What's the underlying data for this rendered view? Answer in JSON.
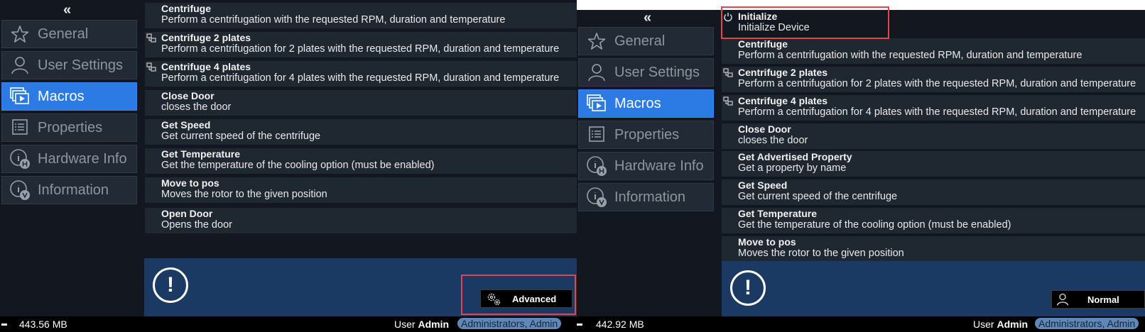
{
  "left": {
    "collapse_label": "«",
    "nav": [
      {
        "label": "General",
        "icon": "star-icon"
      },
      {
        "label": "User Settings",
        "icon": "user-icon"
      },
      {
        "label": "Macros",
        "icon": "macros-icon"
      },
      {
        "label": "Properties",
        "icon": "properties-icon"
      },
      {
        "label": "Hardware Info",
        "icon": "hardware-info-icon"
      },
      {
        "label": "Information",
        "icon": "information-icon"
      }
    ],
    "commands": [
      {
        "title": "Centrifuge",
        "desc": "Perform a centrifugation with the requested RPM, duration and temperature"
      },
      {
        "title": "Centrifuge 2 plates",
        "desc": "Perform a centrifugation for 2 plates with the requested RPM, duration and temperature",
        "icon": "plates-icon"
      },
      {
        "title": "Centrifuge 4 plates",
        "desc": "Perform a centrifugation for 4 plates with the requested RPM, duration and temperature",
        "icon": "plates-icon"
      },
      {
        "title": "Close Door",
        "desc": "closes the door"
      },
      {
        "title": "Get Speed",
        "desc": "Get current speed of the centrifuge"
      },
      {
        "title": "Get Temperature",
        "desc": "Get the temperature of the cooling option (must be enabled)"
      },
      {
        "title": "Move to pos",
        "desc": "Moves the rotor to the given position"
      },
      {
        "title": "Open Door",
        "desc": "Opens the door"
      }
    ],
    "alert_symbol": "!",
    "mode_button": {
      "label": "Advanced",
      "icon": "gears-icon"
    },
    "status": {
      "memory": "443.56 MB",
      "user_prefix": "User",
      "user_name": "Admin",
      "roles": "Administrators, Admin"
    }
  },
  "right": {
    "collapse_label": "«",
    "nav": [
      {
        "label": "General",
        "icon": "star-icon"
      },
      {
        "label": "User Settings",
        "icon": "user-icon"
      },
      {
        "label": "Macros",
        "icon": "macros-icon"
      },
      {
        "label": "Properties",
        "icon": "properties-icon"
      },
      {
        "label": "Hardware Info",
        "icon": "hardware-info-icon"
      },
      {
        "label": "Information",
        "icon": "information-icon"
      }
    ],
    "commands": [
      {
        "title": "Initialize",
        "desc": "Initialize Device",
        "icon": "power-icon"
      },
      {
        "title": "Centrifuge",
        "desc": "Perform a centrifugation with the requested RPM, duration and temperature"
      },
      {
        "title": "Centrifuge 2 plates",
        "desc": "Perform a centrifugation for 2 plates with the requested RPM, duration and temperature",
        "icon": "plates-icon"
      },
      {
        "title": "Centrifuge 4 plates",
        "desc": "Perform a centrifugation for 4 plates with the requested RPM, duration and temperature",
        "icon": "plates-icon"
      },
      {
        "title": "Close Door",
        "desc": "closes the door"
      },
      {
        "title": "Get Advertised Property",
        "desc": "Get a property by name"
      },
      {
        "title": "Get Speed",
        "desc": "Get current speed of the centrifuge"
      },
      {
        "title": "Get Temperature",
        "desc": "Get the temperature of the cooling option (must be enabled)"
      },
      {
        "title": "Move to pos",
        "desc": "Moves the rotor to the given position"
      }
    ],
    "alert_symbol": "!",
    "mode_button": {
      "label": "Normal",
      "icon": "user-icon"
    },
    "status": {
      "memory": "442.92 MB",
      "user_prefix": "User",
      "user_name": "Admin",
      "roles": "Administrators, Admin"
    }
  },
  "colors": {
    "accent": "#2c7be5",
    "info_bar": "#1a3a63",
    "highlight": "#e0474c",
    "background": "#131820"
  }
}
